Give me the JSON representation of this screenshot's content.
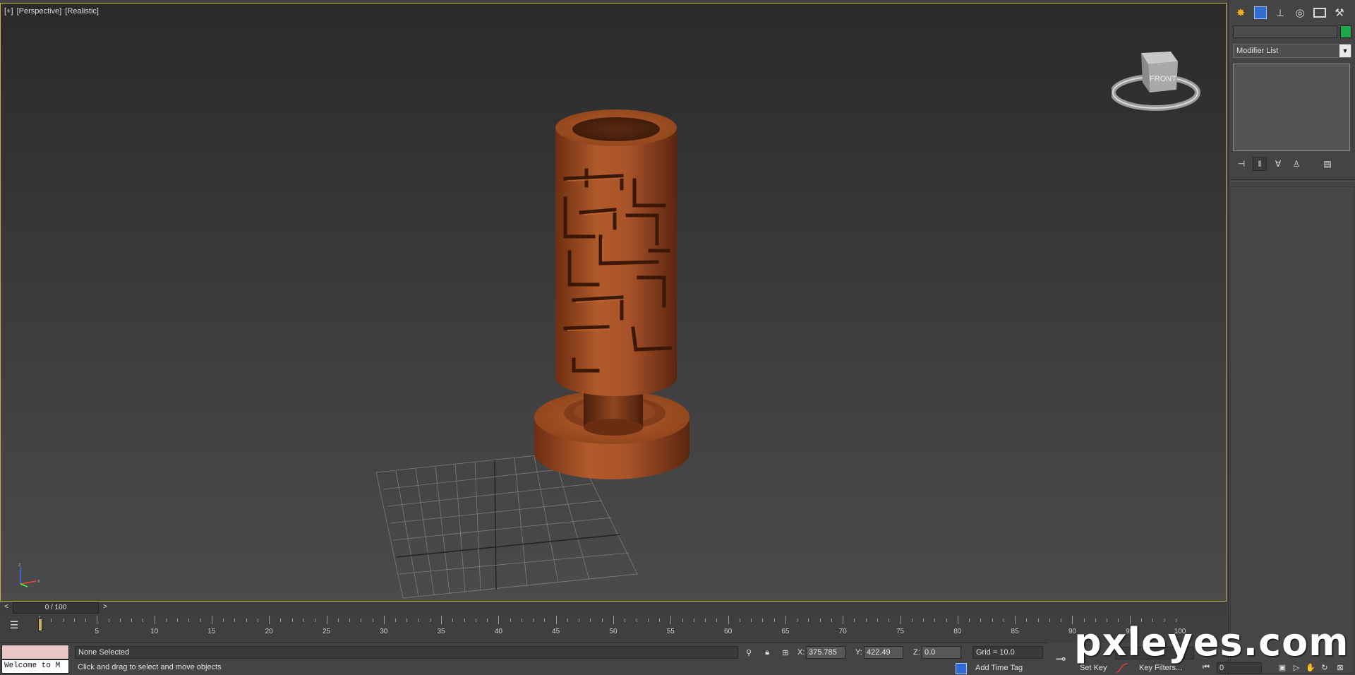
{
  "viewport": {
    "label_plus": "[+]",
    "label_view": "[Perspective]",
    "label_shading": "[Realistic]",
    "viewcube_face": "FRONT"
  },
  "command_panel": {
    "tabs": [
      "create-icon",
      "modify-icon",
      "hierarchy-icon",
      "motion-icon",
      "display-icon",
      "utilities-icon"
    ],
    "object_color": "#1fa64a",
    "modifier_list": "Modifier List"
  },
  "time_slider": {
    "prev": "<",
    "position": "0 / 100",
    "next": ">"
  },
  "track_bar": {
    "ticks": [
      "5",
      "10",
      "15",
      "20",
      "25",
      "30",
      "35",
      "40",
      "45",
      "50",
      "55",
      "60",
      "65",
      "70",
      "75",
      "80",
      "85",
      "90",
      "95",
      "100"
    ]
  },
  "status": {
    "maxscript_text": "Welcome to M",
    "selection": "None Selected",
    "prompt": "Click and drag to select and move objects",
    "x_label": "X:",
    "x_value": "375.785",
    "y_label": "Y:",
    "y_value": "422.49",
    "z_label": "Z:",
    "z_value": "0.0",
    "grid": "Grid = 10.0",
    "add_time_tag": "Add Time Tag"
  },
  "animation": {
    "set_key": "Set Key",
    "key_filters": "Key Filters...",
    "frame": "0"
  },
  "watermark": "pxleyes.com"
}
